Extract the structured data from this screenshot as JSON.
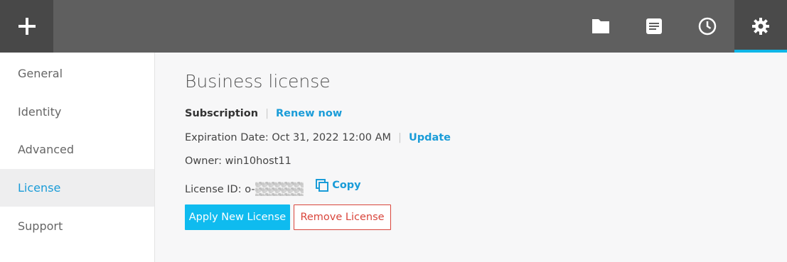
{
  "colors": {
    "topbar": "#5f5f5f",
    "accent": "#0fb6e8",
    "link": "#1a9cd8",
    "danger": "#d9453b"
  },
  "topbar": {
    "add_icon": "plus-icon",
    "icons": [
      "folder-icon",
      "document-icon",
      "clock-icon",
      "gear-icon"
    ]
  },
  "sidebar": {
    "items": [
      {
        "label": "General"
      },
      {
        "label": "Identity"
      },
      {
        "label": "Advanced"
      },
      {
        "label": "License"
      },
      {
        "label": "Support"
      }
    ],
    "active": "License"
  },
  "main": {
    "title": "Business license",
    "subscription_label": "Subscription",
    "renew_link": "Renew now",
    "expiration": "Expiration Date: Oct 31, 2022 12:00 AM",
    "update_link": "Update",
    "owner": "Owner: win10host11",
    "license_id_prefix": "License ID: o-",
    "copy_label": "Copy",
    "apply_button": "Apply New License",
    "remove_button": "Remove License"
  }
}
